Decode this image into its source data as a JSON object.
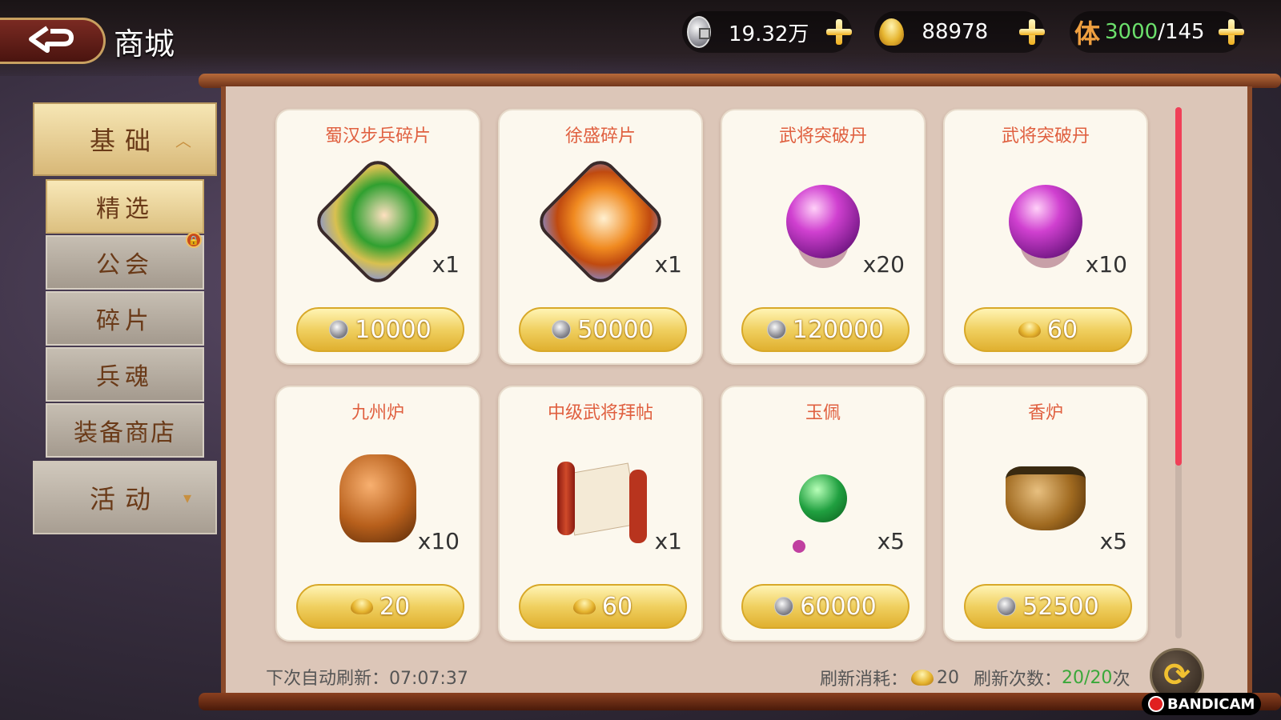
{
  "header": {
    "title": "商城",
    "silver": "19.32万",
    "gold": "88978",
    "stamina_label": "体",
    "stamina_current": "3000",
    "stamina_max": "/145"
  },
  "menu": {
    "categories": [
      {
        "label": "基础",
        "state": "expanded",
        "chevron": "︿"
      },
      {
        "label": "活动",
        "state": "collapsed",
        "chevron": "▾"
      }
    ],
    "subitems": [
      {
        "label": "精选",
        "selected": true
      },
      {
        "label": "公会"
      },
      {
        "label": "碎片"
      },
      {
        "label": "兵魂"
      },
      {
        "label": "装备商店"
      }
    ]
  },
  "items": [
    {
      "name": "蜀汉步兵碎片",
      "qty": "x1",
      "price": "10000",
      "currency": "coin-icon",
      "icon": "infantry-fragment-icon"
    },
    {
      "name": "徐盛碎片",
      "qty": "x1",
      "price": "50000",
      "currency": "coin-icon",
      "icon": "xusheng-fragment-icon"
    },
    {
      "name": "武将突破丹",
      "qty": "x20",
      "price": "120000",
      "currency": "coin-icon",
      "icon": "breakthrough-pill-icon"
    },
    {
      "name": "武将突破丹",
      "qty": "x10",
      "price": "60",
      "currency": "ingot-icon",
      "icon": "breakthrough-pill-icon"
    },
    {
      "name": "九州炉",
      "qty": "x10",
      "price": "20",
      "currency": "ingot-icon",
      "icon": "incense-burner-icon"
    },
    {
      "name": "中级武将拜帖",
      "qty": "x1",
      "price": "60",
      "currency": "ingot-icon",
      "icon": "invitation-scroll-icon"
    },
    {
      "name": "玉佩",
      "qty": "x5",
      "price": "60000",
      "currency": "coin-icon",
      "icon": "jade-pendant-icon"
    },
    {
      "name": "香炉",
      "qty": "x5",
      "price": "52500",
      "currency": "coin-icon",
      "icon": "censer-icon"
    }
  ],
  "footer": {
    "timer_label": "下次自动刷新：",
    "timer_value": "07:07:37",
    "cost_label": "刷新消耗：",
    "cost_value": "20",
    "count_label": "刷新次数：",
    "count_value": "20/20",
    "count_unit": "次"
  },
  "scroll_position": 0.0,
  "watermark": "BANDICAM",
  "colors": {
    "accent_red": "#e06040",
    "gold": "#f0d060",
    "green": "#3aa83a"
  }
}
